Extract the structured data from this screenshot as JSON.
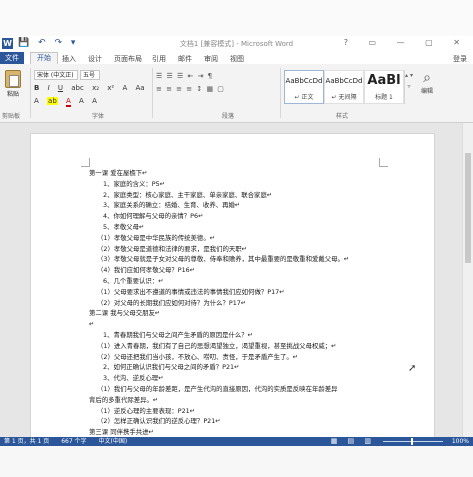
{
  "window": {
    "title": "文档1 [兼容模式] - Microsoft Word",
    "logo": "W",
    "quick_access": "💾 ↶ ↷ ▾",
    "controls": "? ▭ — ▢ ✕"
  },
  "tabs": {
    "file": "文件",
    "items": [
      "开始",
      "插入",
      "设计",
      "页面布局",
      "引用",
      "邮件",
      "审阅",
      "视图"
    ],
    "active_index": 0,
    "login": "登录"
  },
  "ribbon": {
    "paste_label": "粘贴",
    "font_name": "宋体 (中文正)",
    "font_size": "五号",
    "format_buttons": [
      "B",
      "I",
      "U",
      "abc",
      "x₂",
      "x²",
      "A",
      "Aa"
    ],
    "format_row2": [
      "A",
      "ab",
      "A",
      "A",
      "A"
    ],
    "groups": {
      "clipboard": "剪贴板",
      "font": "字体",
      "paragraph": "段落",
      "styles": "样式",
      "editing": "编辑"
    },
    "paragraph_icons": "☰ ☰ ☰ ⇤ ⇥ ¶\n≡ ≡ ≡ ≡ ↕ ▦ ▢",
    "styles": [
      {
        "preview": "AaBbCcDd",
        "name": "↵ 正文"
      },
      {
        "preview": "AaBbCcDd",
        "name": "↵ 无间隔"
      },
      {
        "preview": "AaBl",
        "name": "标题 1"
      }
    ],
    "style_scroll": "▴ ▾ ▿",
    "edit_label": "编辑",
    "colors": {
      "accent": "#2b579a",
      "highlight": "#ffff00",
      "font_color": "#c00000"
    }
  },
  "document": {
    "lines": [
      {
        "text": "第一课   爱在屋檐下↵",
        "level": 0
      },
      {
        "text": "1、家庭的含义：P5↵",
        "level": 1
      },
      {
        "text": "2、家庭类型：核心家庭、主干家庭、单亲家庭、联合家庭↵",
        "level": 1
      },
      {
        "text": "3、家庭关系的确立：结婚、生育、收养、再婚↵",
        "level": 1
      },
      {
        "text": "4、你如何理解与父母的亲情？P6↵",
        "level": 1
      },
      {
        "text": "5、孝敬父母↵",
        "level": 1
      },
      {
        "text": "（1）孝敬父母是中华民族的传统美德。↵",
        "level": 2
      },
      {
        "text": "（2）孝敬父母是道德和法律的要求，是我们的天职↵",
        "level": 2
      },
      {
        "text": "（3）孝敬父母就是子女对父母的尊敬、侍奉和赡养，其中最重要的是敬重和爱戴父母。↵",
        "level": 2
      },
      {
        "text": "（4）我们应如何孝敬父母？P16↵",
        "level": 2
      },
      {
        "text": "6、几个重要认识：↵",
        "level": 1
      },
      {
        "text": "（1）父母要求出不遵道的事情或违法的事情我们应如何做？P17↵",
        "level": 2
      },
      {
        "text": "（2）对父母的长期我们应如何对待？为什么？P17↵",
        "level": 2
      },
      {
        "text": "第二课   我与父母交朋友↵",
        "level": 0
      },
      {
        "text": "↵",
        "level": 0
      },
      {
        "text": "1、青春期我们与父母之间产生矛盾的原因是什么？↵",
        "level": 1
      },
      {
        "text": "（1）进入青春期，我们有了自己的思想渴望独立，渴望重视，甚至挑战父母权威；↵",
        "level": 2
      },
      {
        "text": "（2）父母还把我们当小孩，不放心、唠叨、责怪，于是矛盾产生了。↵",
        "level": 2
      },
      {
        "text": "2、如何正确认识我们与父母之间的矛盾？P21↵",
        "level": 1
      },
      {
        "text": "3、代沟、逆反心理↵",
        "level": 1
      },
      {
        "text": "（1）我们与父母的年龄差距，是产生代沟的直接原因，代沟的实质是反映在年龄差异",
        "level": 2
      },
      {
        "text": "背后的多重代际差异。↵",
        "level": 0
      },
      {
        "text": "（1）逆反心理的主要表现：P21↵",
        "level": 2
      },
      {
        "text": "（2）怎样正确认识我们的逆反心理？P21↵",
        "level": 2
      },
      {
        "text": "第三课   同伴携手共进↵",
        "level": 0
      }
    ]
  },
  "status": {
    "page": "第 1 页，共 1 页",
    "words": "667 个字",
    "lang": "中文(中国)",
    "view_icons": "▦ ▤ ▥",
    "zoom_minus": "−",
    "zoom_plus": "+",
    "zoom": "100%"
  }
}
